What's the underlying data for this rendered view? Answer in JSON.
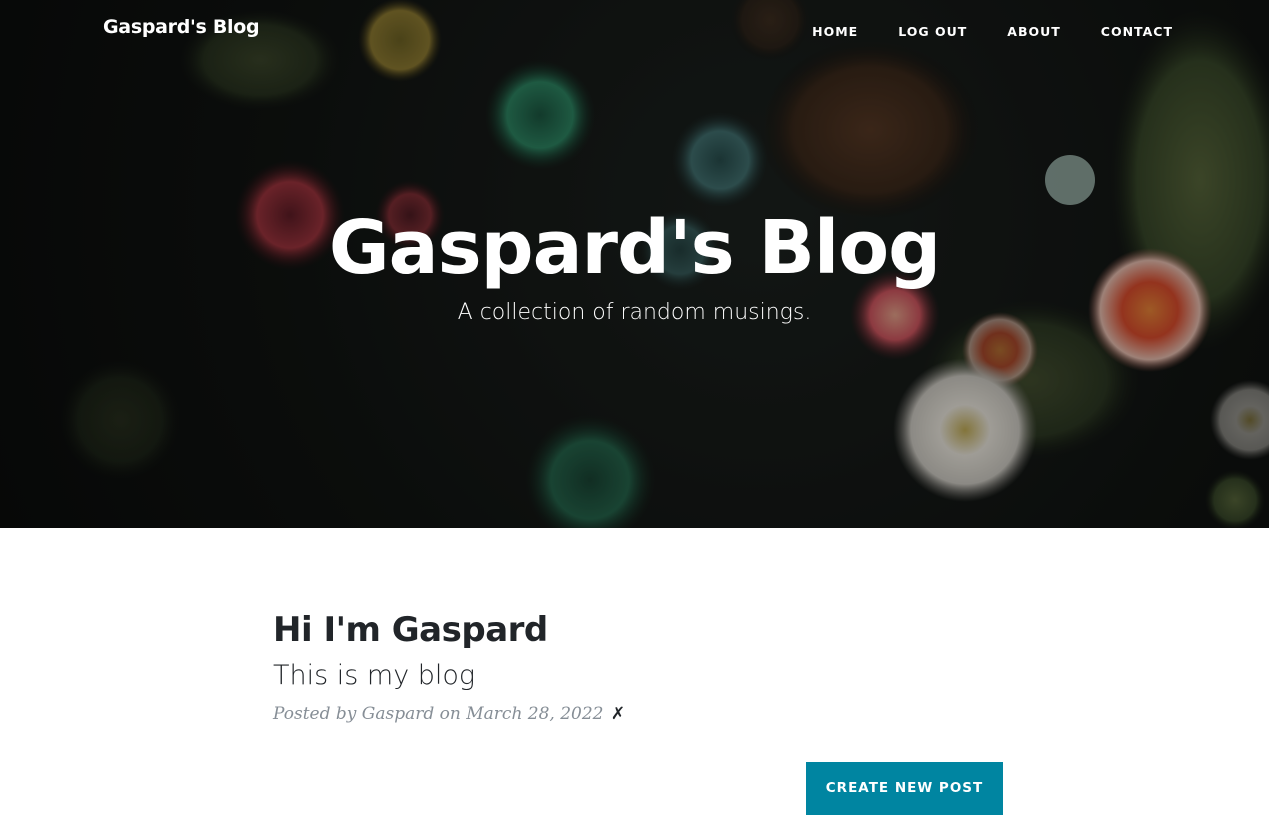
{
  "nav": {
    "brand": "Gaspard's Blog",
    "links": [
      {
        "label": "HOME"
      },
      {
        "label": "LOG OUT"
      },
      {
        "label": "ABOUT"
      },
      {
        "label": "CONTACT"
      }
    ]
  },
  "hero": {
    "title": "Gaspard's Blog",
    "subtitle": "A collection of random musings."
  },
  "post": {
    "title": "Hi I'm Gaspard",
    "subtitle": "This is my blog",
    "meta_prefix": "Posted by",
    "author": "Gaspard",
    "meta_on": "on",
    "date": "March 28, 2022",
    "delete_label": "✗"
  },
  "actions": {
    "create_label": "CREATE NEW POST"
  },
  "colors": {
    "accent": "#0085a1",
    "text_dark": "#212529",
    "meta_gray": "#868e96"
  }
}
